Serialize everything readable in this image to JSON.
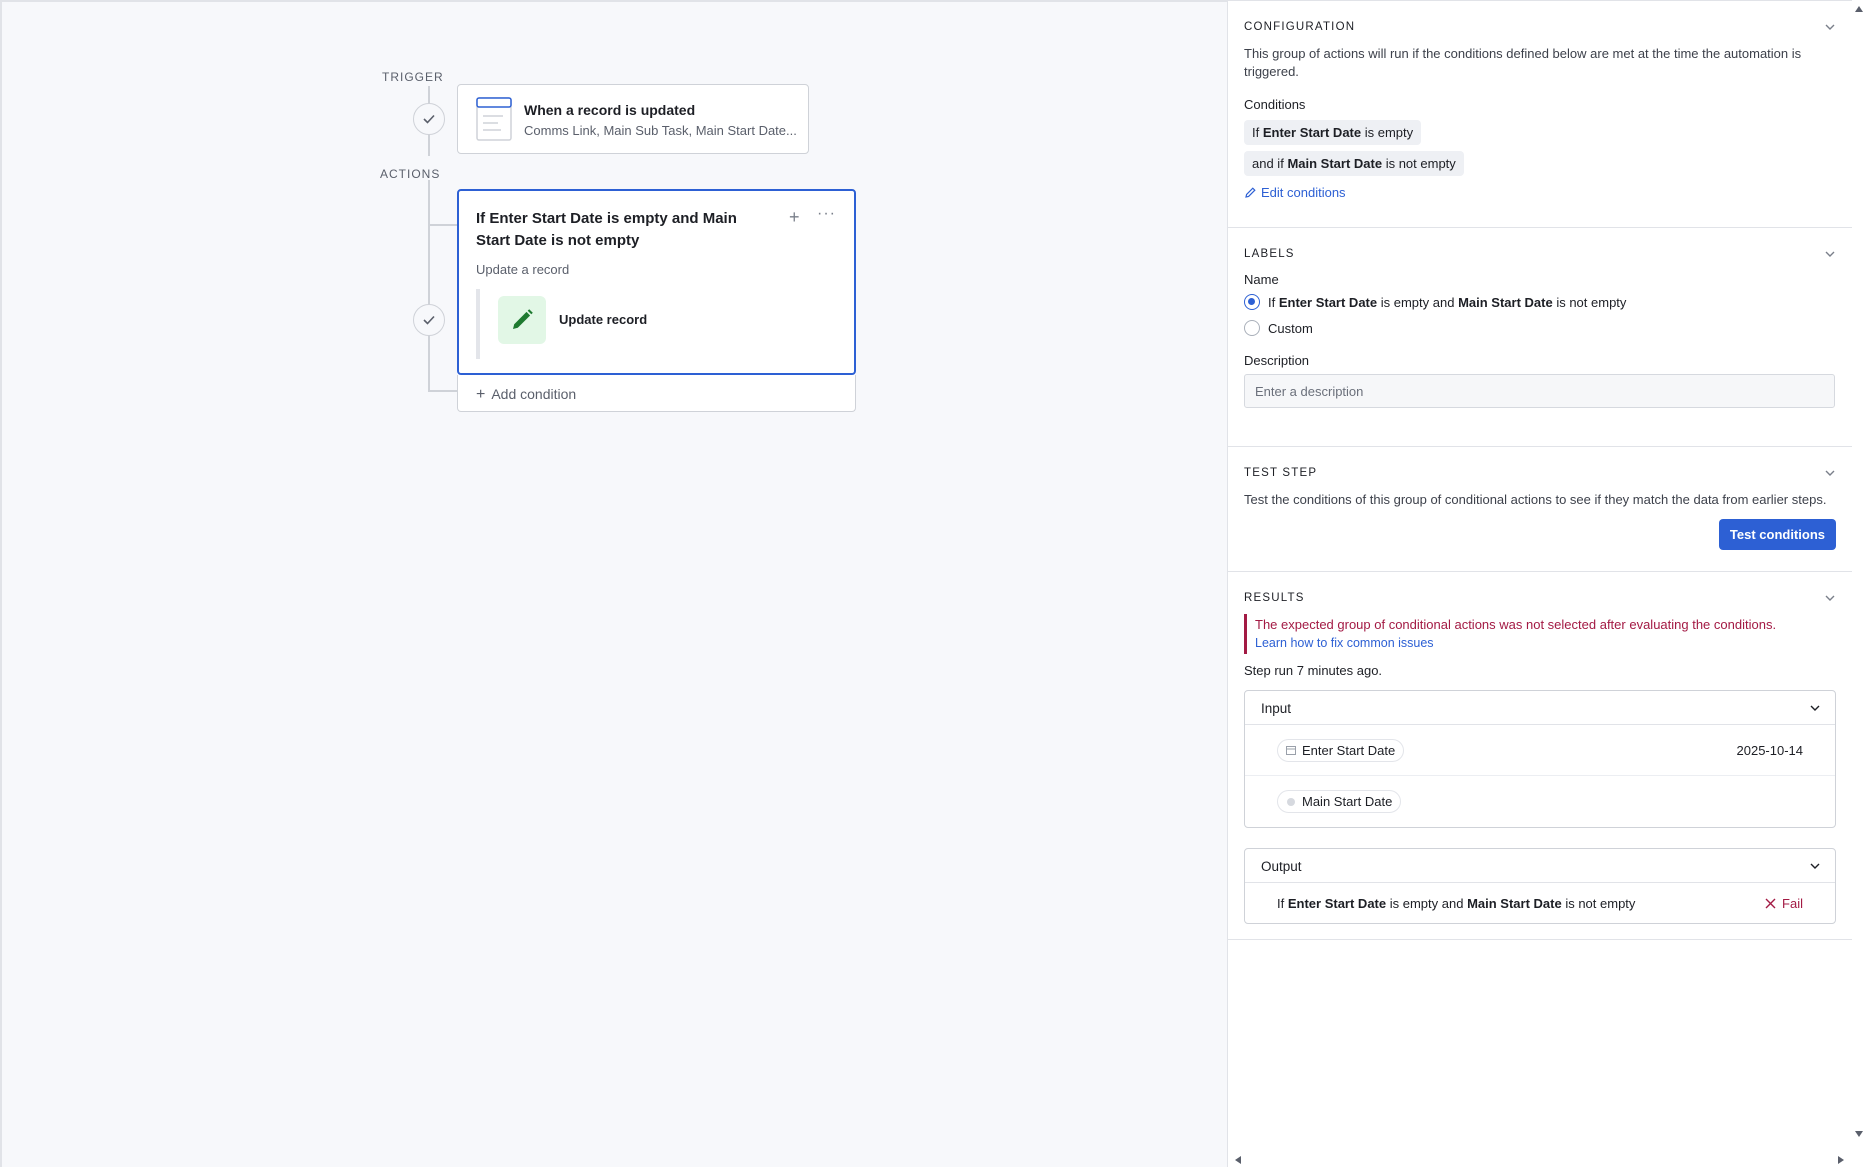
{
  "canvas": {
    "trigger_label": "TRIGGER",
    "actions_label": "ACTIONS",
    "trigger_card": {
      "title": "When a record is updated",
      "subtitle": "Comms Link, Main Sub Task, Main Start Date..."
    },
    "action_card": {
      "title": "If Enter Start Date is empty and Main Start Date is not empty",
      "plus": "+",
      "more": "···",
      "subtitle": "Update a record",
      "inner_step": "Update record"
    },
    "add_condition": "Add condition",
    "add_condition_plus": "+"
  },
  "panel": {
    "configuration": {
      "title": "CONFIGURATION",
      "description": "This group of actions will run if the conditions defined below are met at the time the automation is triggered.",
      "conditions_label": "Conditions",
      "cond1": {
        "prefix": "If",
        "field": "Enter Start Date",
        "op": "is empty"
      },
      "cond2": {
        "prefix": "and if",
        "field": "Main Start Date",
        "op": "is not empty"
      },
      "edit_link": "Edit conditions"
    },
    "labels": {
      "title": "LABELS",
      "name_label": "Name",
      "opt_auto": {
        "w1": "If",
        "f1": "Enter Start Date",
        "w2": "is empty and",
        "f2": "Main Start Date",
        "w3": "is not empty"
      },
      "opt_custom": "Custom",
      "description_label": "Description",
      "description_placeholder": "Enter a description"
    },
    "test_step": {
      "title": "TEST STEP",
      "description": "Test the conditions of this group of conditional actions to see if they match the data from earlier steps.",
      "button": "Test conditions"
    },
    "results": {
      "title": "RESULTS",
      "error": "The expected group of conditional actions was not selected after evaluating the conditions.",
      "error_link": "Learn how to fix common issues",
      "run_info": "Step run 7 minutes ago.",
      "input_title": "Input",
      "inputs": [
        {
          "field": "Enter Start Date",
          "value": "2025-10-14"
        },
        {
          "field": "Main Start Date",
          "value": ""
        }
      ],
      "output_title": "Output",
      "output": {
        "w1": "If",
        "f1": "Enter Start Date",
        "w2": "is empty and",
        "f2": "Main Start Date",
        "w3": "is not empty",
        "status": "Fail"
      }
    }
  },
  "colors": {
    "accent": "#2d60d4",
    "error": "#a31a44",
    "success_bg": "#e2f7e6",
    "success_icon": "#1e7a30"
  }
}
